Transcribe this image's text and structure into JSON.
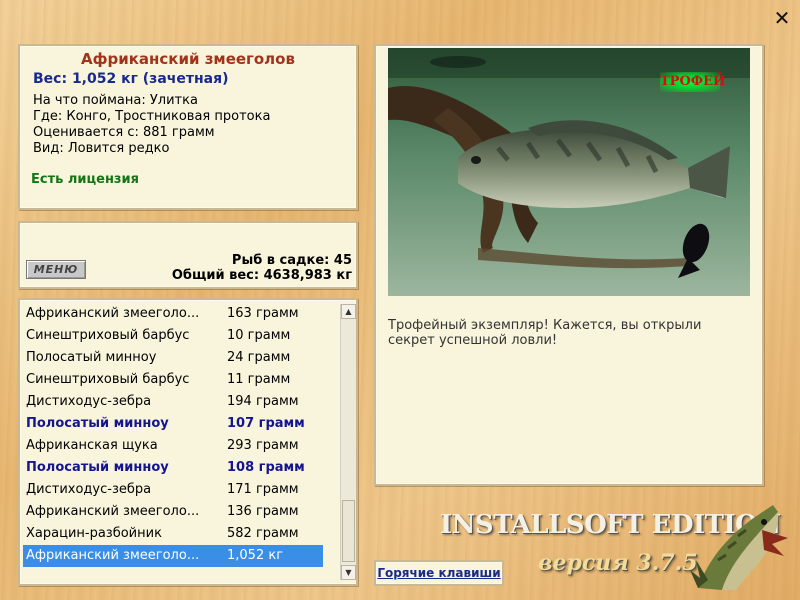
{
  "window": {
    "close_icon": "close-x-icon"
  },
  "fish_info": {
    "name": "Африканский змееголов",
    "weight": "Вес: 1,052 кг (зачетная)",
    "caught_on": "На что поймана: Улитка",
    "location": "Где: Конго, Тростниковая протока",
    "valued_from": "Оценивается с: 881 грамм",
    "rarity": "Вид: Ловится редко",
    "license": "Есть лицензия"
  },
  "stats": {
    "menu_label": "МЕНЮ",
    "fish_count": "Рыб в садке: 45",
    "total_weight": "Общий вес: 4638,983 кг"
  },
  "catch_list": [
    {
      "name": "Африканский змееголо...",
      "weight": "163 грамм",
      "style": "normal"
    },
    {
      "name": "Синештриховый барбус",
      "weight": "10 грамм",
      "style": "normal"
    },
    {
      "name": "Полосатый минноу",
      "weight": "24 грамм",
      "style": "normal"
    },
    {
      "name": "Синештриховый барбус",
      "weight": "11 грамм",
      "style": "normal"
    },
    {
      "name": "Дистиходус-зебра",
      "weight": "194 грамм",
      "style": "normal"
    },
    {
      "name": "Полосатый минноу",
      "weight": "107 грамм",
      "style": "highlight"
    },
    {
      "name": "Африканская щука",
      "weight": "293 грамм",
      "style": "normal"
    },
    {
      "name": "Полосатый минноу",
      "weight": "108 грамм",
      "style": "highlight"
    },
    {
      "name": "Дистиходус-зебра",
      "weight": "171 грамм",
      "style": "normal"
    },
    {
      "name": "Африканский змееголо...",
      "weight": "136 грамм",
      "style": "normal"
    },
    {
      "name": "Харацин-разбойник",
      "weight": "582 грамм",
      "style": "normal"
    },
    {
      "name": "Африканский змееголо...",
      "weight": "1,052 кг",
      "style": "selected"
    }
  ],
  "detail": {
    "trophy_badge": "ТРОФЕЙ",
    "caption": "Трофейный экземпляр! Кажется, вы открыли секрет успешной ловли!"
  },
  "footer": {
    "hotkeys_label": "Горячие клавиши",
    "brand": "INSTALLSOFT EDITION",
    "version": "версия 3.7.5"
  },
  "colors": {
    "title_red": "#a0331a",
    "weight_blue": "#1a2a8c",
    "license_green": "#157516",
    "selection_blue": "#3a8ee6",
    "panel_bg": "#f8f5dc"
  }
}
